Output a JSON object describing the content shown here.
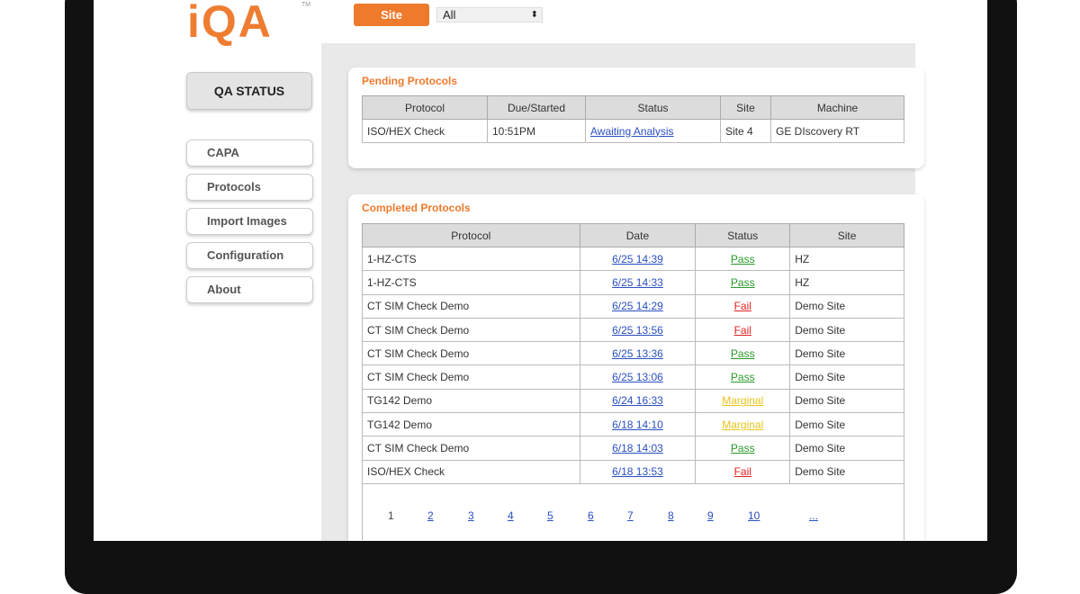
{
  "logo": {
    "text": "iQA",
    "tm": "TM"
  },
  "header": {
    "site_button": "Site",
    "site_select": "All"
  },
  "sidebar": {
    "active": "QA STATUS",
    "items": [
      "CAPA",
      "Protocols",
      "Import Images",
      "Configuration",
      "About"
    ]
  },
  "pending": {
    "title": "Pending Protocols",
    "columns": [
      "Protocol",
      "Due/Started",
      "Status",
      "Site",
      "Machine"
    ],
    "rows": [
      [
        "ISO/HEX Check",
        "10:51PM",
        "Awaiting Analysis",
        "Site 4",
        "GE DIscovery RT"
      ]
    ]
  },
  "completed": {
    "title": "Completed Protocols",
    "columns": [
      "Protocol",
      "Date",
      "Status",
      "Site"
    ],
    "rows": [
      [
        "1-HZ-CTS",
        "6/25 14:39",
        "Pass",
        "HZ"
      ],
      [
        "1-HZ-CTS",
        "6/25 14:33",
        "Pass",
        "HZ"
      ],
      [
        "CT SIM Check Demo",
        "6/25 14:29",
        "Fail",
        "Demo Site"
      ],
      [
        "CT SIM Check Demo",
        "6/25 13:56",
        "Fail",
        "Demo Site"
      ],
      [
        "CT SIM Check Demo",
        "6/25 13:36",
        "Pass",
        "Demo Site"
      ],
      [
        "CT SIM Check Demo",
        "6/25 13:06",
        "Pass",
        "Demo Site"
      ],
      [
        "TG142 Demo",
        "6/24 16:33",
        "Marginal",
        "Demo Site"
      ],
      [
        "TG142 Demo",
        "6/18 14:10",
        "Marginal",
        "Demo Site"
      ],
      [
        "CT SIM Check Demo",
        "6/18 14:03",
        "Pass",
        "Demo Site"
      ],
      [
        "ISO/HEX Check",
        "6/18 13:53",
        "Fail",
        "Demo Site"
      ]
    ]
  },
  "pagination": {
    "current": "1",
    "pages": [
      "2",
      "3",
      "4",
      "5",
      "6",
      "7",
      "8",
      "9",
      "10",
      "..."
    ]
  },
  "colors": {
    "accent": "#ee7a2c",
    "pass": "#2a9a2a",
    "fail": "#e02020",
    "marginal": "#e8c418",
    "link": "#2a4fc0"
  }
}
